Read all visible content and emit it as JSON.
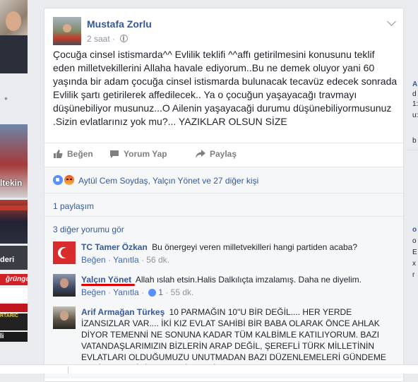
{
  "post": {
    "author": "Mustafa Zorlu",
    "time": "2 saat",
    "text": "Çocuğa cinsel istismarda^^ Evlilik teklifi ^^affı getirilmesini konusunu teklif eden milletvekillerini Allaha havale ediyorum..Bu ne demek oluyor yani 60 yaşında bir adam çocuğa cinsel istismarda bulunacak tecavüz edecek sonrada Evlilik şartı getirilerek affedilecek.. Ya o çocuğun yaşayacağı travmayı düşünebiliyor musunuz...O Ailenin yaşayacaği durumu düşünebiliyormusunuz .Sizin evlatlarınız yok mu?... YAZIKLAR OLSUN SİZE"
  },
  "actions": {
    "like": "Beğen",
    "comment": "Yorum Yap",
    "share": "Paylaş"
  },
  "reactions": {
    "summary": "Aytül Cem Soydaş, Yalçın Yönet ve 27 diğer kişi",
    "icons": [
      "like-icon",
      "angry-icon"
    ],
    "colors": {
      "like": "#5890ff",
      "angry": "#e9542d"
    }
  },
  "shares": "1 paylaşım",
  "more_comments": "3 diğer yorumu gör",
  "comments": [
    {
      "name": "TC Tamer Özkan",
      "text": "Bu önergeyi veren milletvekilleri hangi partiden acaba?",
      "like": "Beğen",
      "reply": "Yanıtla",
      "time": "56 dk."
    },
    {
      "name": "Yalçın Yönet",
      "text": "Allah ıslah etsin.Halis Dalkılıçta imzalamış. Daha ne diyelim.",
      "like": "Beğen",
      "reply": "Yanıtla",
      "likes": "1",
      "time": "55 dk."
    },
    {
      "name": "Arif Armağan Türkeş",
      "text": "10 PARMAĞIN 10\"U BİR DEĞİL.... HER YERDE İZANSIZLAR VAR.... İKİ KIZ EVLAT SAHİBİ BİR BABA OLARAK ÖNCE AHLAK DİYOR TEMENNİ NE SONUNA KADAR TÜM KALBİMLE KATILIYORUM. BAZI VATANDAŞLARIMIZIN BİZLERİN ARAP DEĞİL, ŞEREFLİ TÜRK MİLLETİNİN EVLATLARI OLDUĞUMUZU UNUTMADAN BAZI DÜZENLEMELERİ GÜNDEME GETİRMELERİNİ TEMENNİ EDERİM."
    }
  ],
  "left_column": {
    "captions": [
      "ltekin",
      "ğrünge",
      "deri",
      "RTARIC",
      "li"
    ]
  },
  "right_column": {
    "texts": [
      "A",
      "d",
      "1:",
      "u:",
      "b",
      "o",
      "o",
      "E",
      "x",
      "r"
    ]
  },
  "accent": "#365899"
}
